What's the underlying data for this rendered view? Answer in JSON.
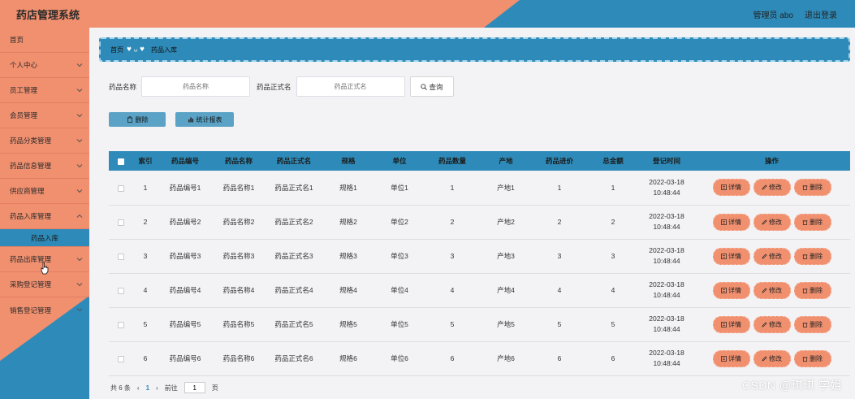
{
  "header": {
    "app_title": "药店管理系统",
    "user_label": "管理员 abo",
    "logout_label": "退出登录"
  },
  "colors": {
    "accent_orange": "#f0906f",
    "accent_blue": "#2e8bb9"
  },
  "sidebar": {
    "items": [
      {
        "label": "首页"
      },
      {
        "label": "个人中心"
      },
      {
        "label": "员工管理"
      },
      {
        "label": "会员管理"
      },
      {
        "label": "药品分类管理"
      },
      {
        "label": "药品信息管理"
      },
      {
        "label": "供应商管理"
      },
      {
        "label": "药品入库管理"
      },
      {
        "label": "药品入库"
      },
      {
        "label": "药品出库管理"
      },
      {
        "label": "采购登记管理"
      },
      {
        "label": "销售登记管理"
      }
    ]
  },
  "breadcrumb": {
    "home": "首页",
    "current": "药品入库"
  },
  "search": {
    "name_label": "药品名称",
    "name_placeholder": "药品名称",
    "formal_label": "药品正式名",
    "formal_placeholder": "药品正式名",
    "button": "查询"
  },
  "actions": {
    "delete": "删除",
    "stats": "统计报表"
  },
  "table": {
    "headers": [
      "索引",
      "药品编号",
      "药品名称",
      "药品正式名",
      "规格",
      "单位",
      "药品数量",
      "产地",
      "药品进价",
      "总金额",
      "登记时间",
      "操作"
    ],
    "rows": [
      [
        "1",
        "药品编号1",
        "药品名称1",
        "药品正式名1",
        "规格1",
        "单位1",
        "1",
        "产地1",
        "1",
        "1",
        "2022-03-18",
        "10:48:44"
      ],
      [
        "2",
        "药品编号2",
        "药品名称2",
        "药品正式名2",
        "规格2",
        "单位2",
        "2",
        "产地2",
        "2",
        "2",
        "2022-03-18",
        "10:48:44"
      ],
      [
        "3",
        "药品编号3",
        "药品名称3",
        "药品正式名3",
        "规格3",
        "单位3",
        "3",
        "产地3",
        "3",
        "3",
        "2022-03-18",
        "10:48:44"
      ],
      [
        "4",
        "药品编号4",
        "药品名称4",
        "药品正式名4",
        "规格4",
        "单位4",
        "4",
        "产地4",
        "4",
        "4",
        "2022-03-18",
        "10:48:44"
      ],
      [
        "5",
        "药品编号5",
        "药品名称5",
        "药品正式名5",
        "规格5",
        "单位5",
        "5",
        "产地5",
        "5",
        "5",
        "2022-03-18",
        "10:48:44"
      ],
      [
        "6",
        "药品编号6",
        "药品名称6",
        "药品正式名6",
        "规格6",
        "单位6",
        "6",
        "产地6",
        "6",
        "6",
        "2022-03-18",
        "10:48:44"
      ]
    ],
    "op_detail": "详情",
    "op_edit": "修改",
    "op_delete": "删除"
  },
  "pager": {
    "total": "共 6 条",
    "prev": "‹",
    "page": "1",
    "next": "›",
    "goto_label": "前往",
    "goto_value": "1",
    "page_suffix": "页"
  },
  "watermark": "CSDN @琪琪 学姐"
}
